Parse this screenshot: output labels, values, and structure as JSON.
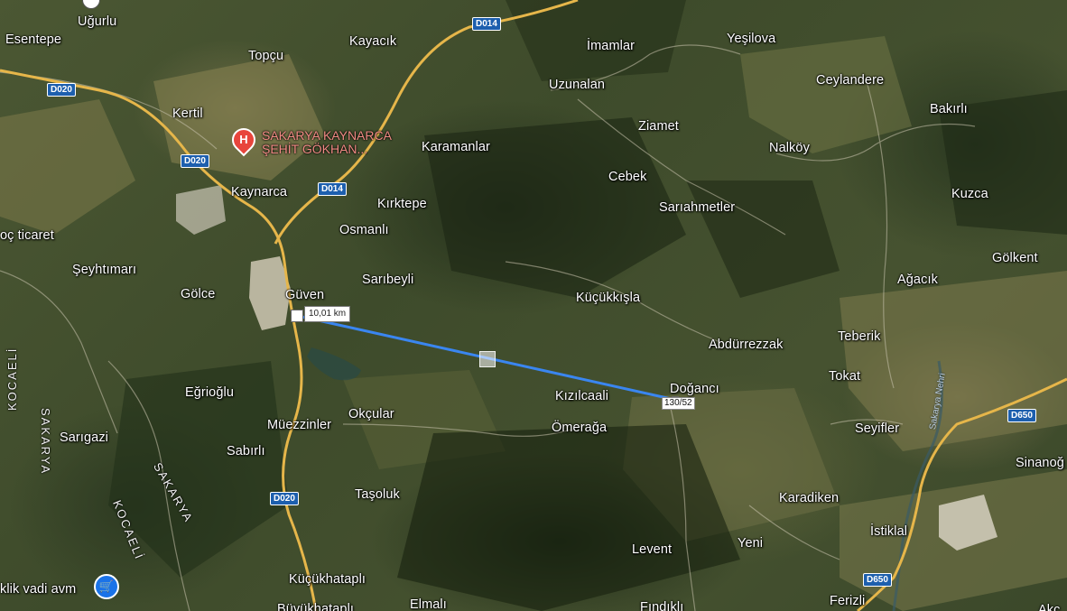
{
  "places": {
    "ugurlu": "Uğurlu",
    "esentepe": "Esentepe",
    "topcu": "Topçu",
    "kayacik": "Kayacık",
    "imamlar": "İmamlar",
    "yesilova": "Yeşilova",
    "uzunalan": "Uzunalan",
    "ceylandere": "Ceylandere",
    "bakirli": "Bakırlı",
    "kertil": "Kertil",
    "ziamet": "Ziamet",
    "karamanlar": "Karamanlar",
    "nalkoy": "Nalköy",
    "cebek": "Cebek",
    "kaynarca": "Kaynarca",
    "kirktepe": "Kırktepe",
    "kuzca": "Kuzca",
    "sariahmetler": "Sarıahmetler",
    "osmanli": "Osmanlı",
    "ticaret": "oç ticaret",
    "golkent": "Gölkent",
    "seyhtimari": "Şeyhtımarı",
    "saribeyli": "Sarıbeyli",
    "agacik": "Ağacık",
    "golce": "Gölce",
    "guven": "Güven",
    "kucukkisla": "Küçükkışla",
    "teberik": "Teberik",
    "abdurrezzak": "Abdürrezzak",
    "tokat": "Tokat",
    "egrioglu": "Eğrioğlu",
    "dogan": "Doğancı",
    "kizilcaali": "Kızılcaali",
    "muezzinler": "Müezzinler",
    "okcular": "Okçular",
    "seyifler": "Seyifler",
    "omeraga": "Ömerağa",
    "sarigazi": "Sarıgazi",
    "sabirli": "Sabırlı",
    "sinanoglu": "Sinanoğ",
    "tasoluk": "Taşoluk",
    "karadiken": "Karadiken",
    "istiklal": "İstiklal",
    "levent": "Levent",
    "yeni": "Yeni",
    "kucukhatapli": "Küçükhataplı",
    "elmali": "Elmalı",
    "findikli": "Fındıklı",
    "buyukhatapli": "Büyükhataplı",
    "ferizli": "Ferizli",
    "akca": "Akç"
  },
  "provinces": {
    "kocaeli_west": "KOCAELİ",
    "sakarya_west": "SAKARYA",
    "sakarya_south": "SAKARYA",
    "kocaeli_south": "KOCAELİ"
  },
  "river": "Sakarya Nehri",
  "roads": {
    "d014_top": "D014",
    "d014_mid": "D014",
    "d020_a": "D020",
    "d020_b": "D020",
    "d020_c": "D020",
    "d650_a": "D650",
    "d650_b": "D650"
  },
  "poi": {
    "hospital_icon": "hospital-icon",
    "hospital_glyph": "H",
    "hospital_name_line1": "SAKARYA KAYNARCA",
    "hospital_name_line2": "ŞEHİT GÖKHAN...",
    "mall_icon": "shopping-cart-icon",
    "mall_name": "klik vadi avm"
  },
  "measurement": {
    "distance": "10,01 km",
    "endpoint_label": "130/52",
    "line_color": "#3a86f0"
  },
  "colors": {
    "label_text": "#ffffff",
    "road_shield": "#1d5fae",
    "highway": "#e6b64a",
    "hospital": "#e8453c",
    "shopping": "#1a73e8"
  }
}
